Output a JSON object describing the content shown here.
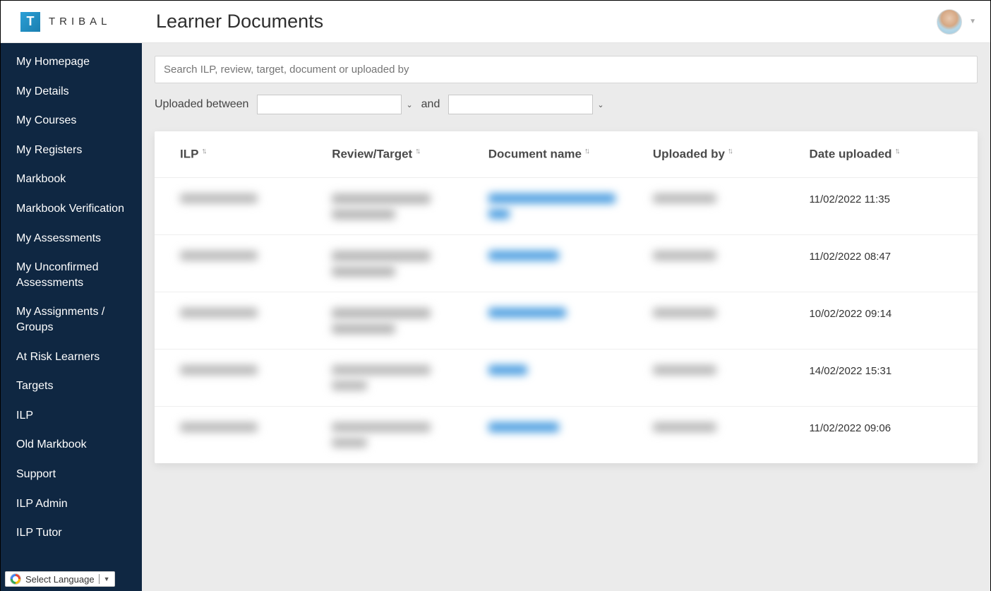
{
  "header": {
    "logo_letter": "T",
    "logo_text": "TRIBAL",
    "page_title": "Learner Documents"
  },
  "sidebar": {
    "items": [
      {
        "label": "My Homepage"
      },
      {
        "label": "My Details"
      },
      {
        "label": "My Courses"
      },
      {
        "label": "My Registers"
      },
      {
        "label": "Markbook"
      },
      {
        "label": "Markbook Verification"
      },
      {
        "label": "My Assessments"
      },
      {
        "label": "My Unconfirmed Assessments"
      },
      {
        "label": "My Assignments / Groups"
      },
      {
        "label": "At Risk Learners"
      },
      {
        "label": "Targets"
      },
      {
        "label": "ILP"
      },
      {
        "label": "Old Markbook"
      },
      {
        "label": "Support"
      },
      {
        "label": "ILP Admin"
      },
      {
        "label": "ILP Tutor"
      }
    ],
    "language_label": "Select Language"
  },
  "filters": {
    "search_placeholder": "Search ILP, review, target, document or uploaded by",
    "uploaded_between_label": "Uploaded between",
    "and_label": "and"
  },
  "table": {
    "columns": {
      "ilp": "ILP",
      "review_target": "Review/Target",
      "document_name": "Document name",
      "uploaded_by": "Uploaded by",
      "date_uploaded": "Date uploaded"
    },
    "rows": [
      {
        "date_uploaded": "11/02/2022 11:35"
      },
      {
        "date_uploaded": "11/02/2022 08:47"
      },
      {
        "date_uploaded": "10/02/2022 09:14"
      },
      {
        "date_uploaded": "14/02/2022 15:31"
      },
      {
        "date_uploaded": "11/02/2022 09:06"
      }
    ]
  }
}
